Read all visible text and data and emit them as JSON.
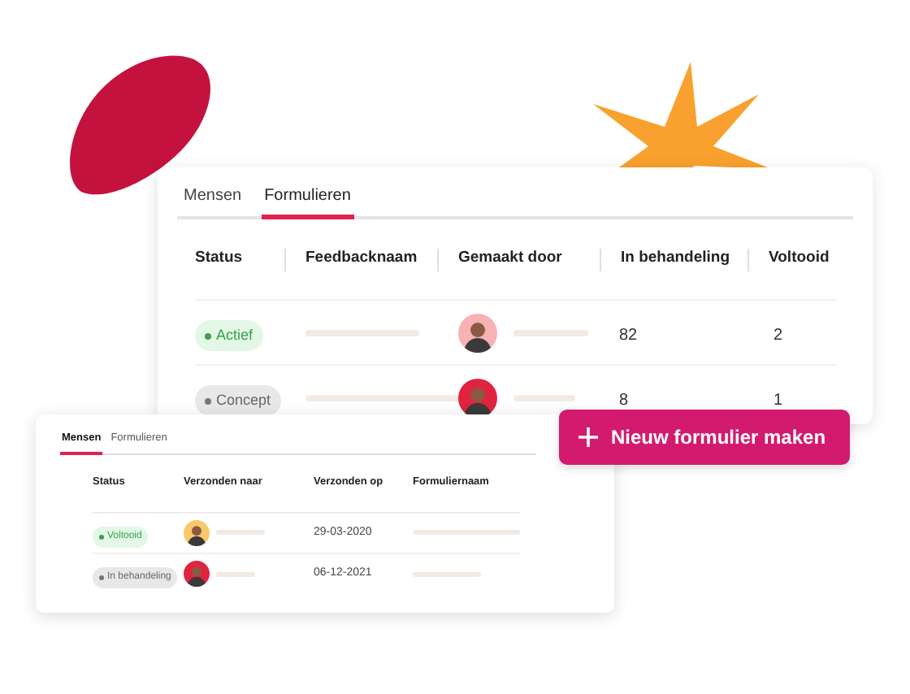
{
  "main_card": {
    "tabs": [
      {
        "label": "Mensen",
        "selected": false
      },
      {
        "label": "Formulieren",
        "selected": true
      }
    ],
    "columns": [
      "Status",
      "Feedbacknaam",
      "Gemaakt door",
      "In behandeling",
      "Voltooid"
    ],
    "rows": [
      {
        "status": {
          "label": "Actief",
          "kind": "success"
        },
        "avatar": {
          "color": "#f6b2b4"
        },
        "in_progress": "82",
        "completed": "2"
      },
      {
        "status": {
          "label": "Concept",
          "kind": "neutral"
        },
        "avatar": {
          "color": "#e0233f"
        },
        "in_progress": "8",
        "completed": "1"
      }
    ]
  },
  "new_form_button": {
    "label": "Nieuw formulier maken"
  },
  "second_card": {
    "tabs": [
      {
        "label": "Mensen",
        "selected": true
      },
      {
        "label": "Formulieren",
        "selected": false
      }
    ],
    "columns": [
      "Status",
      "Verzonden naar",
      "Verzonden op",
      "Formuliernaam"
    ],
    "rows": [
      {
        "status": {
          "label": "Voltooid",
          "kind": "success"
        },
        "avatar": {
          "color": "#f7c96a"
        },
        "sent_on": "29-03-2020"
      },
      {
        "status": {
          "label": "In behandeling",
          "kind": "neutral"
        },
        "avatar": {
          "color": "#e0233f"
        },
        "sent_on": "06-12-2021"
      }
    ]
  }
}
